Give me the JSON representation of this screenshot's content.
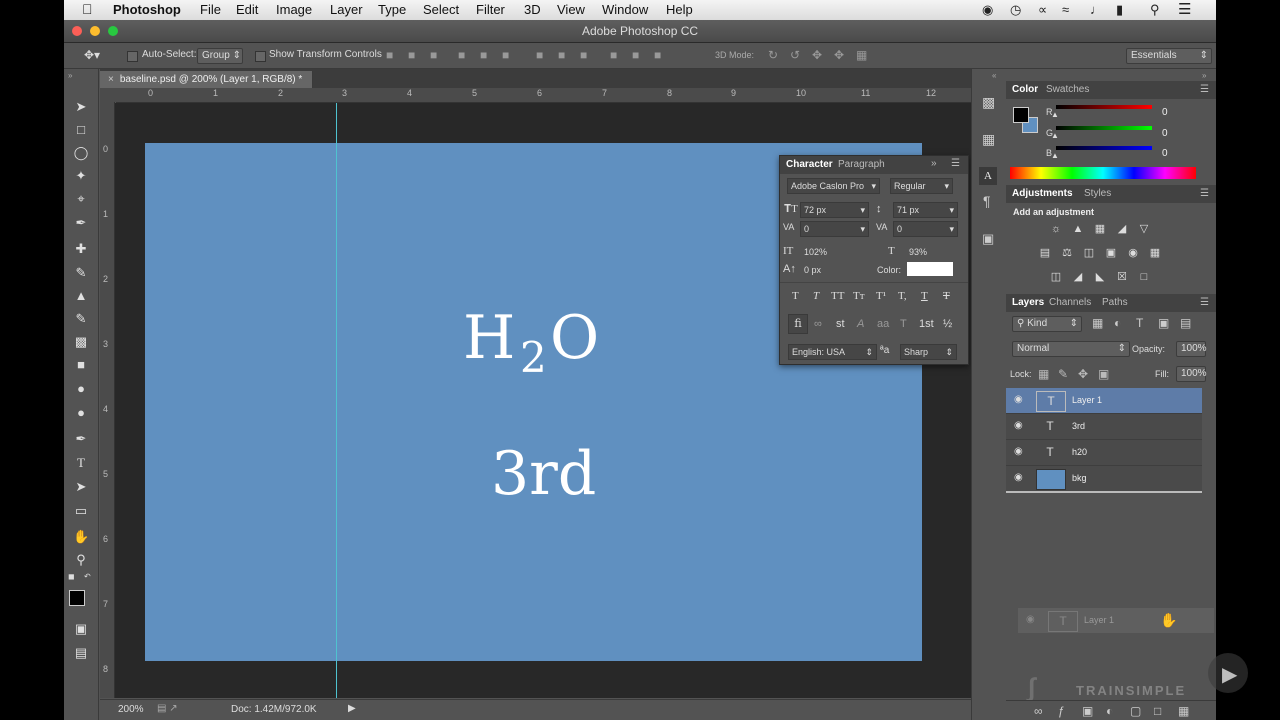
{
  "menubar": {
    "app": "Photoshop",
    "items": [
      "File",
      "Edit",
      "Image",
      "Layer",
      "Type",
      "Select",
      "Filter",
      "3D",
      "View",
      "Window",
      "Help"
    ]
  },
  "window": {
    "title": "Adobe Photoshop CC"
  },
  "options": {
    "auto_select_label": "Auto-Select:",
    "auto_select_value": "Group",
    "transform_label": "Show Transform Controls",
    "mode3d_label": "3D Mode:",
    "workspace": "Essentials"
  },
  "document": {
    "tab_label": "baseline.psd @ 200% (Layer 1, RGB/8) *",
    "ruler_top": [
      "0",
      "1",
      "2",
      "3",
      "4",
      "5",
      "6",
      "7",
      "8",
      "9",
      "10",
      "11",
      "12"
    ],
    "ruler_left": [
      "0",
      "1",
      "2",
      "3",
      "4",
      "5",
      "6",
      "7",
      "8"
    ],
    "text_h": "H",
    "text_2": "2",
    "text_o": "O",
    "text_3rd": "3rd",
    "zoom": "200%",
    "doc_size": "Doc: 1.42M/972.0K"
  },
  "color_panel": {
    "tabs": [
      "Color",
      "Swatches"
    ],
    "r_label": "R",
    "g_label": "G",
    "b_label": "B",
    "r": "0",
    "g": "0",
    "b": "0"
  },
  "adjustments_panel": {
    "tabs": [
      "Adjustments",
      "Styles"
    ],
    "heading": "Add an adjustment"
  },
  "layers_panel": {
    "tabs": [
      "Layers",
      "Channels",
      "Paths"
    ],
    "filter": "Kind",
    "blend_mode": "Normal",
    "opacity_label": "Opacity:",
    "opacity": "100%",
    "lock_label": "Lock:",
    "fill_label": "Fill:",
    "fill": "100%",
    "layers": [
      {
        "name": "Layer 1",
        "type": "text",
        "selected": true
      },
      {
        "name": "3rd",
        "type": "text",
        "selected": false
      },
      {
        "name": "h20",
        "type": "text",
        "selected": false
      },
      {
        "name": "bkg",
        "type": "image",
        "selected": false
      }
    ],
    "drag_ghost": "Layer 1"
  },
  "character_panel": {
    "tabs": [
      "Character",
      "Paragraph"
    ],
    "font_family": "Adobe Caslon Pro",
    "font_style": "Regular",
    "size": "72 px",
    "leading": "71 px",
    "kerning": "0",
    "tracking": "0",
    "vscale": "102%",
    "hscale": "93%",
    "baseline": "0 px",
    "color_label": "Color:",
    "language": "English: USA",
    "antialias": "Sharp"
  },
  "watermark": "TRAINSIMPLE",
  "colors": {
    "artboard": "#6090c0",
    "panel": "#535353",
    "pasteboard": "#282828",
    "selected_layer": "#5e7ca8"
  }
}
